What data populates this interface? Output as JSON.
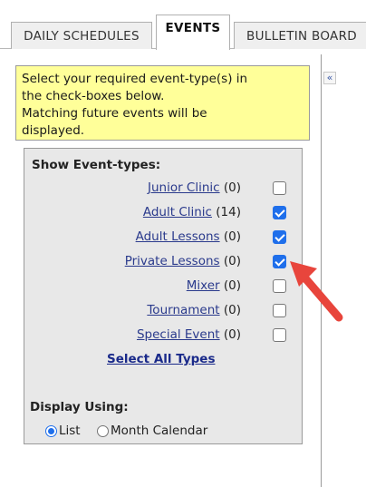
{
  "tabs": [
    {
      "label": "DAILY SCHEDULES"
    },
    {
      "label": "EVENTS"
    },
    {
      "label": "BULLETIN BOARD"
    }
  ],
  "active_tab": "EVENTS",
  "collapse_button": {
    "label": "«"
  },
  "notice": {
    "lines": [
      "Select your required event-type(s) in",
      "the check-boxes below.",
      "Matching future events will be",
      "displayed."
    ]
  },
  "event_types": {
    "title": "Show Event-types:",
    "items": [
      {
        "name": "Junior Clinic",
        "count": "(0)",
        "checked": false
      },
      {
        "name": "Adult Clinic",
        "count": "(14)",
        "checked": true
      },
      {
        "name": "Adult Lessons",
        "count": "(0)",
        "checked": true
      },
      {
        "name": "Private Lessons",
        "count": "(0)",
        "checked": true
      },
      {
        "name": "Mixer",
        "count": "(0)",
        "checked": false
      },
      {
        "name": "Tournament",
        "count": "(0)",
        "checked": false
      },
      {
        "name": "Special Event",
        "count": "(0)",
        "checked": false
      }
    ],
    "select_all_label": "Select All Types"
  },
  "display": {
    "title": "Display Using:",
    "options": [
      {
        "label": "List",
        "selected": true
      },
      {
        "label": "Month Calendar",
        "selected": false
      }
    ]
  },
  "colors": {
    "notice_bg": "#ffff99",
    "panel_bg": "#e8e8e8",
    "link": "#2a3a8c",
    "checkbox_checked": "#1f6feb",
    "annotation_arrow": "#e8453c"
  }
}
